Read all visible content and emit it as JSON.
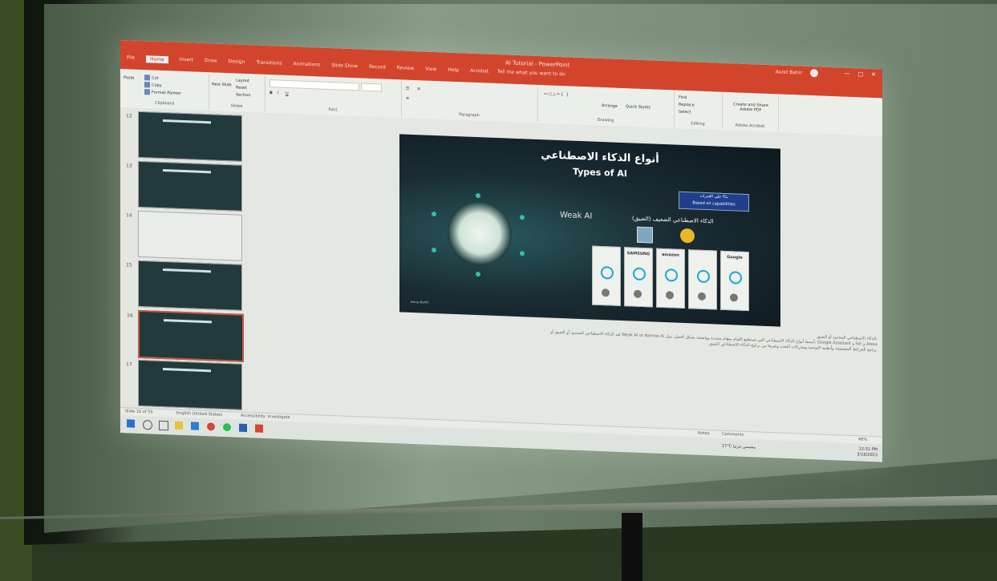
{
  "app": {
    "window_title": "AI Tutorial - PowerPoint",
    "tabs": [
      "File",
      "Home",
      "Insert",
      "Draw",
      "Design",
      "Transitions",
      "Animations",
      "Slide Show",
      "Record",
      "Review",
      "View",
      "Help",
      "Acrobat"
    ],
    "tell_me": "Tell me what you want to do",
    "user_name": "Aurel Bahir"
  },
  "ribbon": {
    "clipboard": {
      "label": "Clipboard",
      "cut": "Cut",
      "copy": "Copy",
      "format_painter": "Format Painter",
      "paste": "Paste"
    },
    "slides": {
      "label": "Slides",
      "new_slide": "New Slide",
      "layout": "Layout",
      "reset": "Reset",
      "section": "Section"
    },
    "font": {
      "label": "Font"
    },
    "paragraph": {
      "label": "Paragraph"
    },
    "drawing": {
      "label": "Drawing",
      "arrange": "Arrange",
      "quick_styles": "Quick Styles"
    },
    "editing": {
      "label": "Editing",
      "find": "Find",
      "replace": "Replace",
      "select": "Select"
    },
    "adobe": {
      "label": "Adobe Acrobat",
      "create_share": "Create and Share Adobe PDF"
    }
  },
  "thumbnails": {
    "numbers": [
      "12",
      "13",
      "14",
      "15",
      "16",
      "17"
    ],
    "active_index": 4
  },
  "slide": {
    "title_ar": "أنواع الذكاء الاصطناعي",
    "title_en": "Types of AI",
    "badge_ar": "بناءً على القدرات",
    "badge_en": "Based on capabilities",
    "weak_ai": "Weak AI",
    "weak_ai_ar": "الذكاء الاصطناعي الضعيف (الضيق)",
    "brands": [
      "",
      "SAMSUNG",
      "amazon",
      "",
      "Google"
    ],
    "credit": "Anne Barth"
  },
  "notes": {
    "line1": "الذكاء الاصطناعي المحدود أو الضيق:",
    "line2": "يُعد الذكاء الاصطناعي المحدود أو الضيق أو Weak AI or Narrow AI أبسط أنواع الذكاء الاصطناعي التي تستطيع القيام بمهام محددة وواضحة بشكل أفضل، مثل: Google Assistant و Siri و Alexa",
    "line3": "برامج الخرائط المتصفحة وأنظمة التوصية ومحركات البحث وغيرها من برامج الذكاء الاصطناعي الضيق."
  },
  "status": {
    "slide_counter": "Slide 16 of 55",
    "language": "English (United States)",
    "accessibility": "Accessibility: Investigate",
    "notes": "Notes",
    "comments": "Comments",
    "zoom": "48%"
  },
  "taskbar": {
    "weather": "17°C  مشمس جزئيا",
    "time": "12:51 PM",
    "date": "3/16/2023"
  },
  "colors": {
    "ribbon_accent": "#d2452c",
    "slide_bg": "#1a2c33",
    "badge": "#1f3f8d",
    "icon_teal": "#2fc2a6"
  }
}
